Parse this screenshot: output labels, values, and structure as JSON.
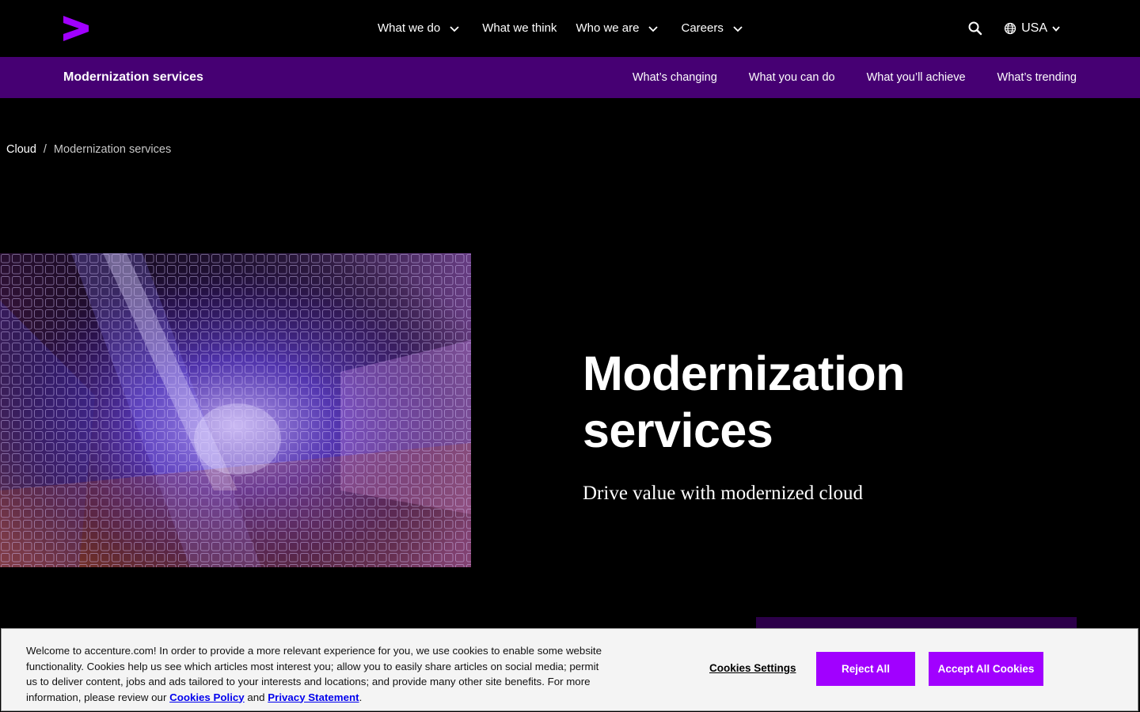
{
  "topnav": {
    "items": [
      {
        "label": "What we do",
        "dropdown": true
      },
      {
        "label": "What we think",
        "dropdown": false
      },
      {
        "label": "Who we are",
        "dropdown": true
      },
      {
        "label": "Careers",
        "dropdown": true
      }
    ],
    "search_icon": "search-icon",
    "locale": "USA"
  },
  "subnav": {
    "title": "Modernization services",
    "links": [
      "What’s changing",
      "What you can do",
      "What you’ll achieve",
      "What’s trending"
    ]
  },
  "breadcrumb": {
    "parent": "Cloud",
    "separator": "/",
    "current": "Modernization services"
  },
  "hero": {
    "title_line1": "Modernization",
    "title_line2": "services",
    "subtitle": "Drive value with modernized cloud"
  },
  "cookie_banner": {
    "text": "Welcome to accenture.com! In order to provide a more relevant experience for you, we use cookies to enable some website functionality. Cookies help us see which articles most interest you; allow you to easily share articles on social media; permit us to deliver content, jobs and ads tailored to your interests and locations; and provide many other site benefits. For more information, please review our",
    "policy_link": "Cookies Policy",
    "conjunction": "and",
    "privacy_link": "Privacy Statement",
    "period": ".",
    "settings_label": "Cookies Settings",
    "reject_label": "Reject All",
    "accept_label": "Accept All Cookies"
  },
  "colors": {
    "brand_purple": "#a100ff",
    "subnav_bg": "#460073",
    "background": "#000000"
  }
}
